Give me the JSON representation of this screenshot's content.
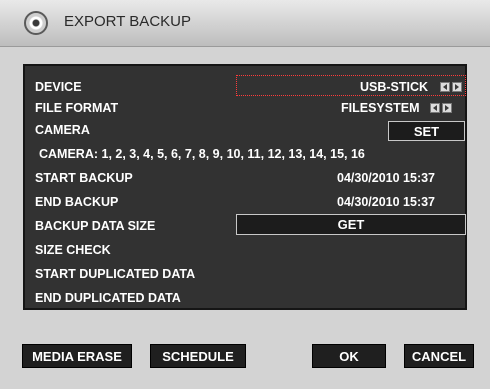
{
  "window": {
    "title": "EXPORT BACKUP",
    "icon": "disc-icon"
  },
  "fields": {
    "device": {
      "label": "DEVICE",
      "value": "USB-STICK"
    },
    "file_format": {
      "label": "FILE FORMAT",
      "value": "FILESYSTEM"
    },
    "camera": {
      "label": "CAMERA",
      "button": "SET"
    },
    "camera_list": "CAMERA: 1, 2, 3, 4, 5, 6, 7, 8, 9, 10, 11, 12, 13, 14, 15, 16",
    "start_backup": {
      "label": "START BACKUP",
      "value": "04/30/2010 15:37"
    },
    "end_backup": {
      "label": "END BACKUP",
      "value": "04/30/2010 15:37"
    },
    "backup_data_size": {
      "label": "BACKUP DATA SIZE",
      "button": "GET"
    },
    "size_check": {
      "label": "SIZE CHECK"
    },
    "start_duplicated": {
      "label": "START DUPLICATED DATA"
    },
    "end_duplicated": {
      "label": "END DUPLICATED DATA"
    }
  },
  "buttons": {
    "media_erase": "MEDIA ERASE",
    "schedule": "SCHEDULE",
    "ok": "OK",
    "cancel": "CANCEL"
  },
  "colors": {
    "panel_bg": "#323232",
    "focus_border": "#ff3b3b",
    "button_bg": "#1f1f1f"
  }
}
